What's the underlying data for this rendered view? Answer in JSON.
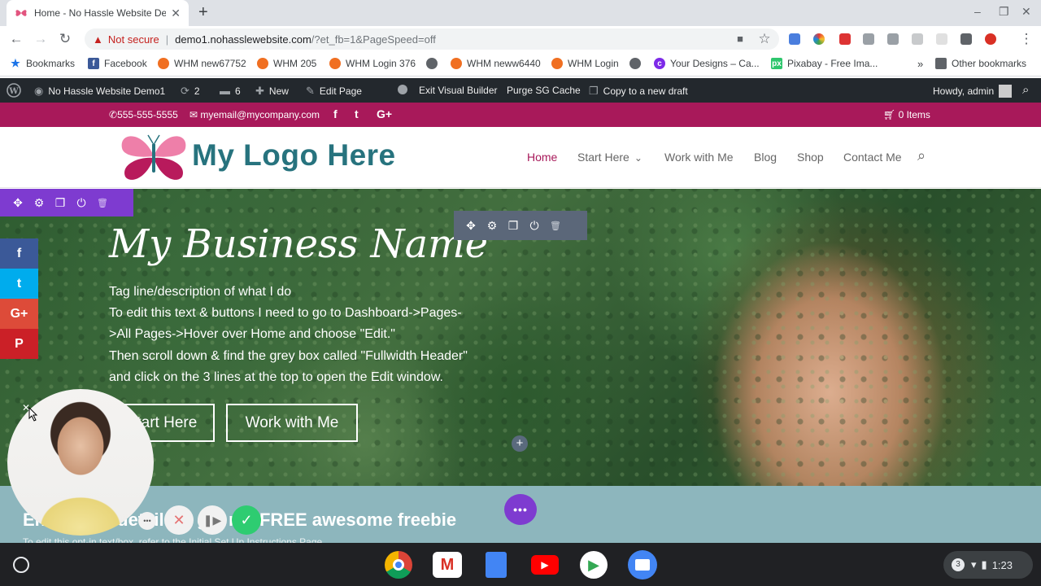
{
  "browser": {
    "tab_title": "Home - No Hassle Website Demo",
    "tab_close": "✕",
    "new_tab": "+",
    "not_secure": "Not secure",
    "url_host": "demo1.nohasslewebsite.com",
    "url_path": "/?et_fb=1&PageSpeed=off",
    "window_controls": [
      "–",
      "❐",
      "✕"
    ],
    "bookmarks": [
      "Bookmarks",
      "Facebook",
      "WHM new67752",
      "WHM 205",
      "WHM Login 376",
      "WHM neww6440",
      "WHM Login",
      "Your Designs – Ca...",
      "Pixabay - Free Ima..."
    ],
    "bookmarks_more": "»",
    "other_bookmarks": "Other bookmarks"
  },
  "wp_admin_bar": {
    "site_name": "No Hassle Website Demo1",
    "updates_count": "2",
    "comments_count": "6",
    "new_label": "New",
    "edit_page": "Edit Page",
    "exit_builder": "Exit Visual Builder",
    "purge_cache": "Purge SG Cache",
    "copy_draft": "Copy to a new draft",
    "howdy": "Howdy, admin"
  },
  "contact_bar": {
    "phone": "555-555-5555",
    "email": "myemail@mycompany.com",
    "social_icons": [
      "f",
      "t",
      "G+"
    ],
    "cart": "0 Items"
  },
  "header": {
    "logo_text": "My Logo Here",
    "nav": [
      "Home",
      "Start Here",
      "Work with Me",
      "Blog",
      "Shop",
      "Contact Me"
    ],
    "start_here_caret": "⌄"
  },
  "hero": {
    "title": "My Business Name",
    "lines": [
      "Tag line/description of what I do",
      "To edit this text & buttons I need to go to Dashboard->Pages-",
      ">All Pages->Hover over Home and choose \"Edit.\"",
      "Then scroll down & find the grey box called \"Fullwidth Header\"",
      "and click on the 3 lines at the top to open the Edit window."
    ],
    "button_start": "Start Here",
    "button_work": "Work with Me",
    "add_module": "+"
  },
  "social_share": [
    "f",
    "t",
    "G+",
    "P"
  ],
  "optin": {
    "title": "Enter your details & get my FREE awesome freebie",
    "subtitle": "To edit this opt-in text/box, refer to the Initial Set Up Instructions Page",
    "more_button": "•••"
  },
  "shelf": {
    "notifications": "3",
    "time": "1:23"
  },
  "colors": {
    "brand_pink": "#a8195a",
    "brand_teal": "#27737e",
    "divi_purple": "#7e3bd0",
    "wp_dark": "#23282d",
    "optin_teal": "#8db6bd"
  }
}
